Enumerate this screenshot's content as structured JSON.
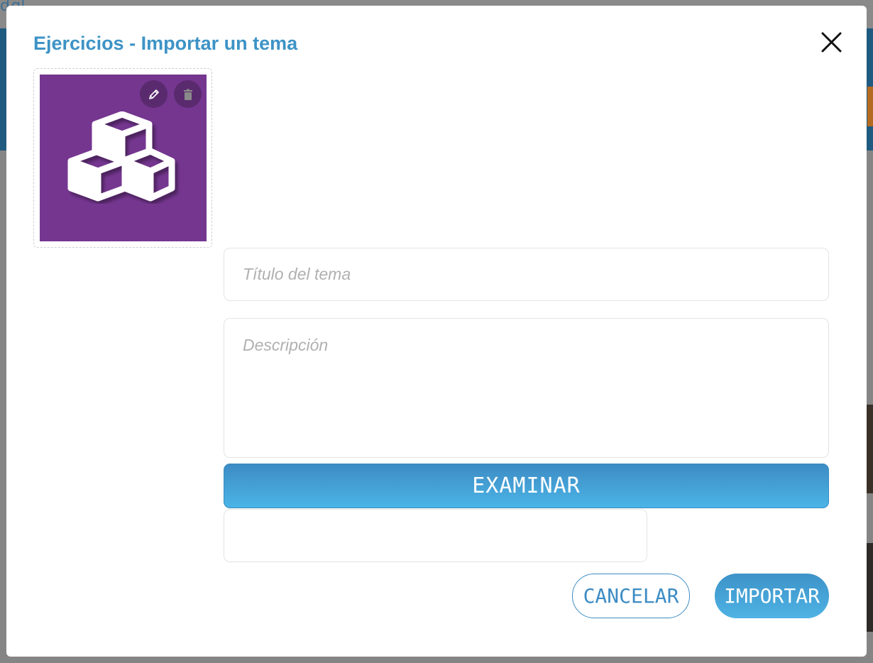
{
  "dialog": {
    "title": "Ejercicios - Importar un tema",
    "close_icon": "close-icon"
  },
  "image": {
    "icon": "cubes-icon",
    "background_color": "#753690",
    "edit_icon": "pencil-icon",
    "delete_icon": "trash-icon"
  },
  "form": {
    "title_placeholder": "Título del tema",
    "title_value": "",
    "description_placeholder": "Descripción",
    "description_value": "",
    "browse_label": "EXAMINAR",
    "file_name": ""
  },
  "actions": {
    "cancel_label": "CANCELAR",
    "import_label": "IMPORTAR"
  },
  "colors": {
    "accent": "#3d93c6",
    "tile": "#753690"
  }
}
